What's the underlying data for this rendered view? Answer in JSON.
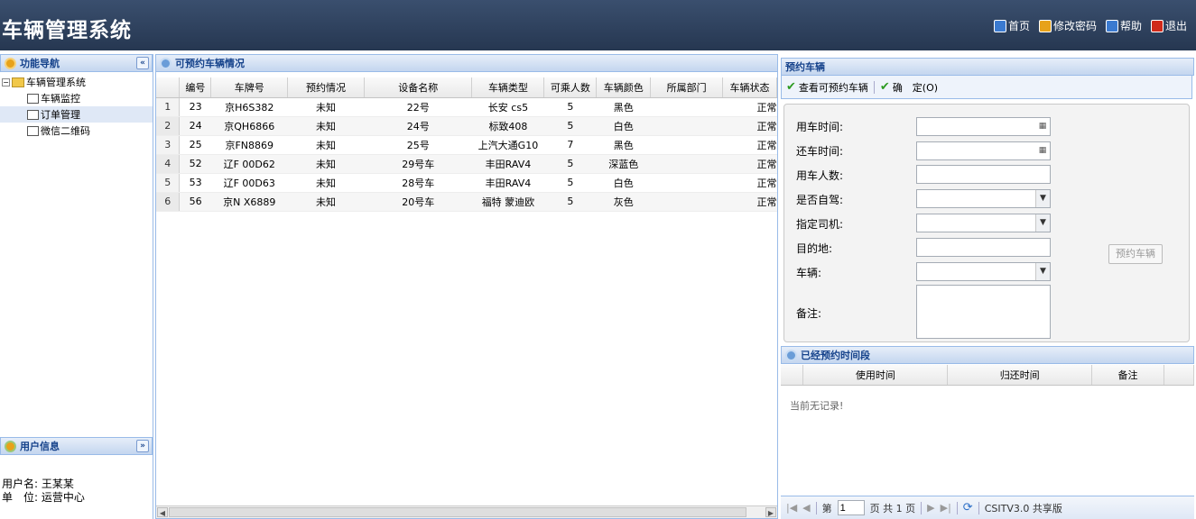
{
  "header": {
    "title": "车辆管理系统",
    "links": [
      {
        "label": "首页",
        "icon": "home-icon",
        "color": "#3a7ad0"
      },
      {
        "label": "修改密码",
        "icon": "edit-password-icon",
        "color": "#e7a21a"
      },
      {
        "label": "帮助",
        "icon": "help-icon",
        "color": "#3a7ad0"
      },
      {
        "label": "退出",
        "icon": "logout-icon",
        "color": "#d02a1a"
      }
    ]
  },
  "nav": {
    "title": "功能导航",
    "tree": {
      "root": "车辆管理系统",
      "items": [
        "车辆监控",
        "订单管理",
        "微信二维码"
      ]
    }
  },
  "user": {
    "title": "用户信息",
    "name_line": "用户名: 王某某",
    "unit_line": "单　位: 运营中心"
  },
  "grid": {
    "title": "可预约车辆情况",
    "columns": [
      "编号",
      "车牌号",
      "预约情况",
      "设备名称",
      "车辆类型",
      "可乘人数",
      "车辆颜色",
      "所属部门",
      "车辆状态"
    ],
    "rows": [
      {
        "rn": "1",
        "cells": [
          "23",
          "京H6S382",
          "未知",
          "22号",
          "长安  cs5",
          "5",
          "黑色",
          "",
          "正常"
        ]
      },
      {
        "rn": "2",
        "cells": [
          "24",
          "京QH6866",
          "未知",
          "24号",
          "标致408",
          "5",
          "白色",
          "",
          "正常"
        ]
      },
      {
        "rn": "3",
        "cells": [
          "25",
          "京FN8869",
          "未知",
          "25号",
          "上汽大通G10",
          "7",
          "黑色",
          "",
          "正常"
        ]
      },
      {
        "rn": "4",
        "cells": [
          "52",
          "辽F 00D62",
          "未知",
          "29号车",
          "丰田RAV4",
          "5",
          "深蓝色",
          "",
          "正常"
        ]
      },
      {
        "rn": "5",
        "cells": [
          "53",
          "辽F 00D63",
          "未知",
          "28号车",
          "丰田RAV4",
          "5",
          "白色",
          "",
          "正常"
        ]
      },
      {
        "rn": "6",
        "cells": [
          "56",
          "京N X6889",
          "未知",
          "20号车",
          "福特 蒙迪欧",
          "5",
          "灰色",
          "",
          "正常"
        ]
      }
    ]
  },
  "booking": {
    "title": "预约车辆",
    "toolbar": {
      "view_label": "查看可预约车辆",
      "confirm_label": "确　定(O)"
    },
    "fields": {
      "start_time": "用车时间:",
      "return_time": "还车时间:",
      "people": "用车人数:",
      "self_drive": "是否自驾:",
      "driver": "指定司机:",
      "destination": "目的地:",
      "vehicle": "车辆:",
      "remark": "备注:"
    },
    "book_button": "预约车辆"
  },
  "booked": {
    "title": "已经预约时间段",
    "columns": [
      "使用时间",
      "归还时间",
      "备注"
    ],
    "empty_text": "当前无记录!",
    "pager": {
      "page_prefix": "第",
      "page_value": "1",
      "page_suffix": "页 共 1 页",
      "version": "CSITV3.0 共享版"
    }
  }
}
